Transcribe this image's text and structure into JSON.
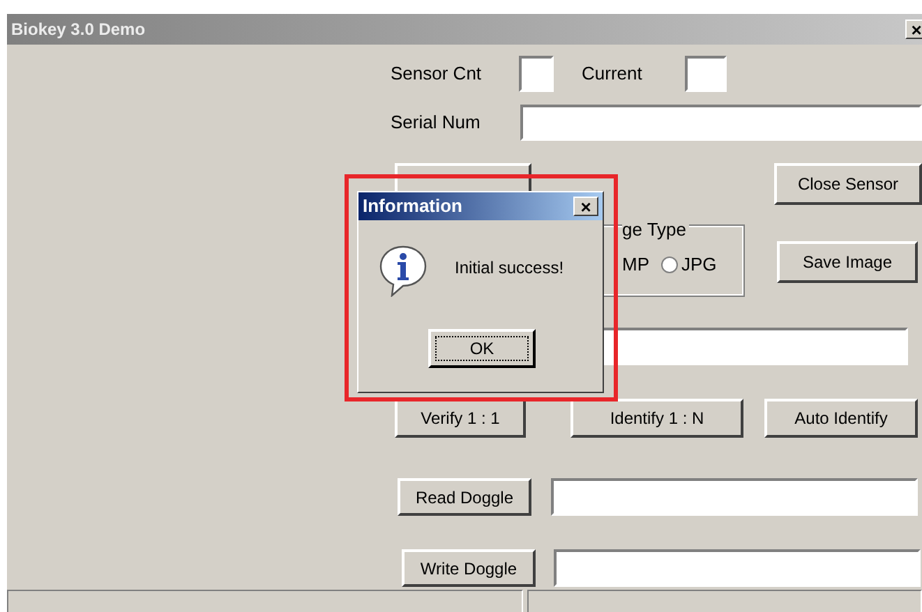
{
  "window": {
    "title": "Biokey 3.0 Demo",
    "close": "×"
  },
  "sensor": {
    "count_label": "Sensor Cnt",
    "current_label": "Current",
    "serial_label": "Serial Num"
  },
  "buttons_top": {
    "close_sensor": "Close  Sensor",
    "save_image": "Save Image"
  },
  "image_type": {
    "legend": "ge Type",
    "bmp_label": "MP",
    "jpg_option": {
      "label": "JPG",
      "selected": false
    }
  },
  "match_buttons": [
    "Verify 1 : 1",
    "Identify 1 : N",
    "Auto Identify"
  ],
  "doggle": [
    {
      "button": "Read Doggle"
    },
    {
      "button": "Write Doggle"
    }
  ],
  "dialog": {
    "title": "Information",
    "close": "×",
    "message": "Initial success!",
    "ok": "OK"
  }
}
